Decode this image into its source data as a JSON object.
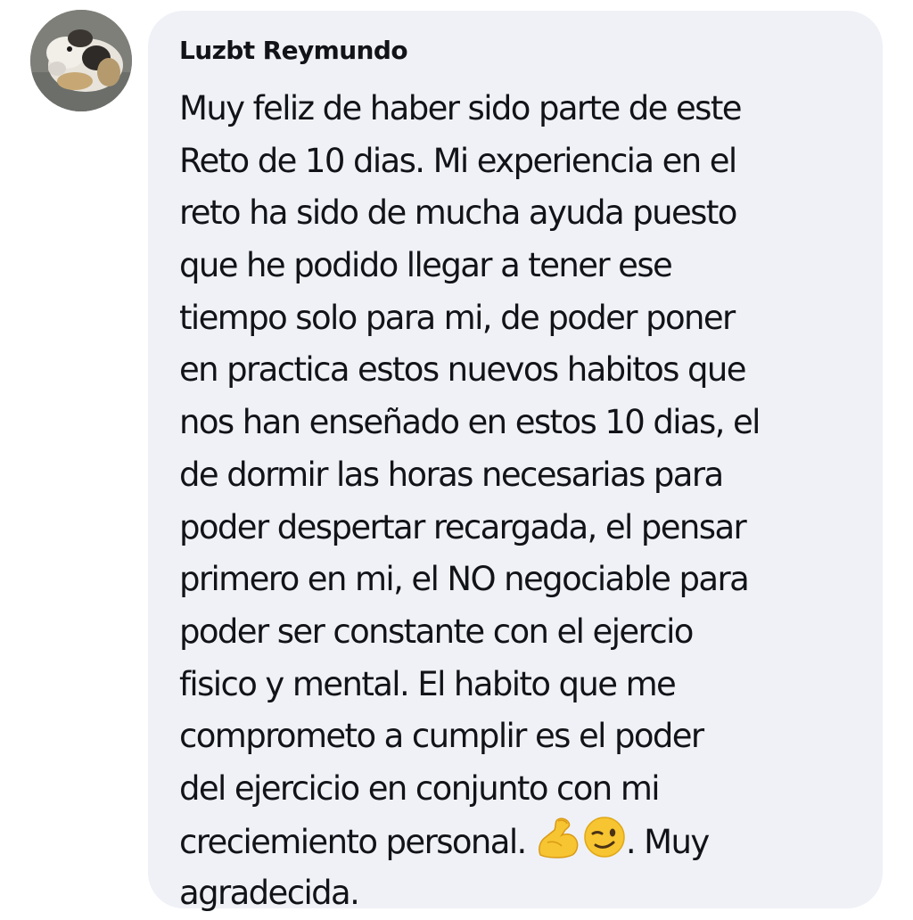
{
  "comment": {
    "author": "Luzbt Reymundo",
    "lines": [
      "Muy feliz de haber sido parte de este",
      "Reto de 10 dias. Mi experiencia en el",
      "reto ha sido de mucha ayuda puesto",
      "que he podido llegar a tener ese",
      "tiempo solo para mi, de poder poner",
      "en practica estos nuevos habitos que",
      "nos han enseñado en estos 10 dias, el",
      "de dormir las horas necesarias para",
      "poder despertar recargada, el pensar",
      "primero en mi, el NO negociable para",
      "poder ser constante con el ejercio",
      "fisico y mental. El habito que me",
      "comprometo a cumplir es el poder",
      "del ejercicio en conjunto con mi"
    ],
    "last_line_start": "creciemiento personal. ",
    "last_line_end": ". Muy",
    "closing_line": "agradecida.",
    "emojis": [
      "flexed-biceps",
      "winking-face"
    ]
  },
  "colors": {
    "bubble_background": "#eff1f6",
    "text": "#111318",
    "emoji_yellow": "#f7c531"
  },
  "icons": {
    "avatar": "profile-photo-dog",
    "emoji_1": "flexed-biceps-icon",
    "emoji_2": "winking-face-icon"
  }
}
